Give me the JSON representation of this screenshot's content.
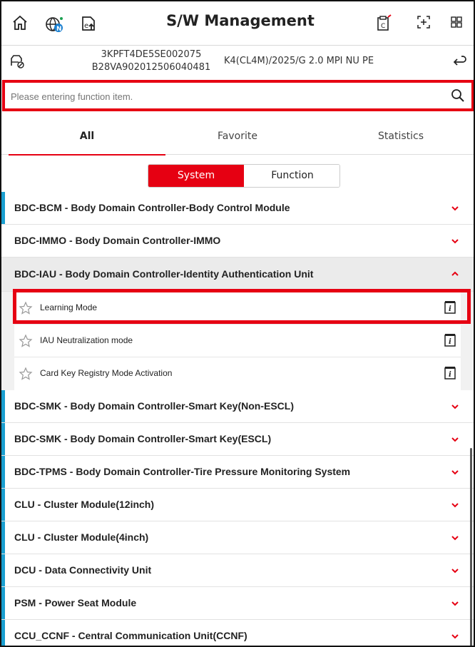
{
  "header": {
    "title": "S/W Management",
    "icons": [
      "home-icon",
      "globe-update-icon",
      "ecu-upload-icon",
      "clipboard-c-icon",
      "expand-plus-icon",
      "grid-menu-icon"
    ]
  },
  "vehicle": {
    "vin": "3KPFT4DE5SE002075",
    "code": "B28VA902012506040481",
    "model": "K4(CL4M)/2025/G 2.0 MPI NU PE"
  },
  "search": {
    "placeholder": "Please entering function item."
  },
  "tabs": [
    {
      "label": "All",
      "active": true
    },
    {
      "label": "Favorite",
      "active": false
    },
    {
      "label": "Statistics",
      "active": false
    }
  ],
  "segment": {
    "system": "System",
    "function": "Function",
    "selected": "System"
  },
  "modules": [
    {
      "label": "BDC-BCM - Body Domain Controller-Body Control Module",
      "expanded": false
    },
    {
      "label": "BDC-IMMO - Body Domain Controller-IMMO",
      "expanded": false
    },
    {
      "label": "BDC-IAU - Body Domain Controller-Identity Authentication Unit",
      "expanded": true,
      "items": [
        "Learning Mode",
        "IAU Neutralization mode",
        "Card Key Registry Mode Activation"
      ]
    },
    {
      "label": "BDC-SMK - Body Domain Controller-Smart Key(Non-ESCL)",
      "expanded": false
    },
    {
      "label": "BDC-SMK - Body Domain Controller-Smart Key(ESCL)",
      "expanded": false
    },
    {
      "label": "BDC-TPMS - Body Domain Controller-Tire Pressure Monitoring System",
      "expanded": false
    },
    {
      "label": "CLU - Cluster Module(12inch)",
      "expanded": false
    },
    {
      "label": "CLU - Cluster Module(4inch)",
      "expanded": false
    },
    {
      "label": "DCU - Data Connectivity Unit",
      "expanded": false
    },
    {
      "label": "PSM - Power Seat Module",
      "expanded": false
    },
    {
      "label": "CCU_CCNF - Central Communication Unit(CCNF)",
      "expanded": false
    }
  ],
  "colors": {
    "accent": "#e60012",
    "module_bar": "#1a9fd0"
  }
}
